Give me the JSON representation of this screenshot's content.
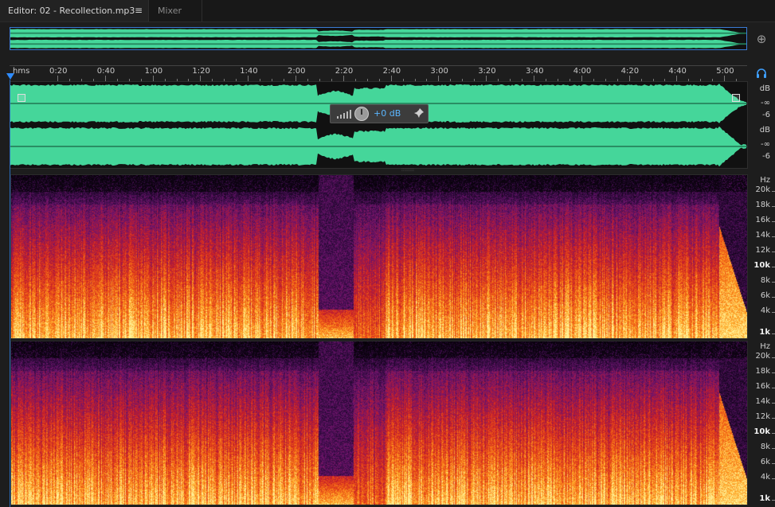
{
  "tabs": {
    "editor_label": "Editor: 02 - Recollection.mp3",
    "menu_glyph": "≡",
    "mixer_label": "Mixer"
  },
  "ruler": {
    "unit_label": "hms",
    "ticks": [
      "0:20",
      "0:40",
      "1:00",
      "1:20",
      "1:40",
      "2:00",
      "2:20",
      "2:40",
      "3:00",
      "3:20",
      "3:40",
      "4:00",
      "4:20",
      "4:40",
      "5:00"
    ]
  },
  "hud": {
    "gain_value": "+0 dB"
  },
  "db_scale": {
    "ch1": [
      "dB",
      "-∞",
      "-6"
    ],
    "ch2": [
      "dB",
      "-∞",
      "-6"
    ]
  },
  "hz_scale": {
    "unit": "Hz",
    "labels": [
      "20k",
      "18k",
      "16k",
      "14k",
      "12k",
      "10k",
      "8k",
      "6k",
      "4k",
      "1k"
    ],
    "bold": [
      "10k",
      "1k"
    ]
  },
  "icons": {
    "zoom": "zoom-icon",
    "headphone": "headphone-icon",
    "pin": "pin-icon",
    "volume_bars": "volume-bars-icon",
    "gain_knob": "gain-knob-icon"
  },
  "colors": {
    "waveform": "#45d69a",
    "waveform_dark": "#111111",
    "accent": "#2f8cff",
    "spectral_low": "#000000",
    "spectral_mid": "#e0301a",
    "spectral_high": "#ffe890"
  }
}
